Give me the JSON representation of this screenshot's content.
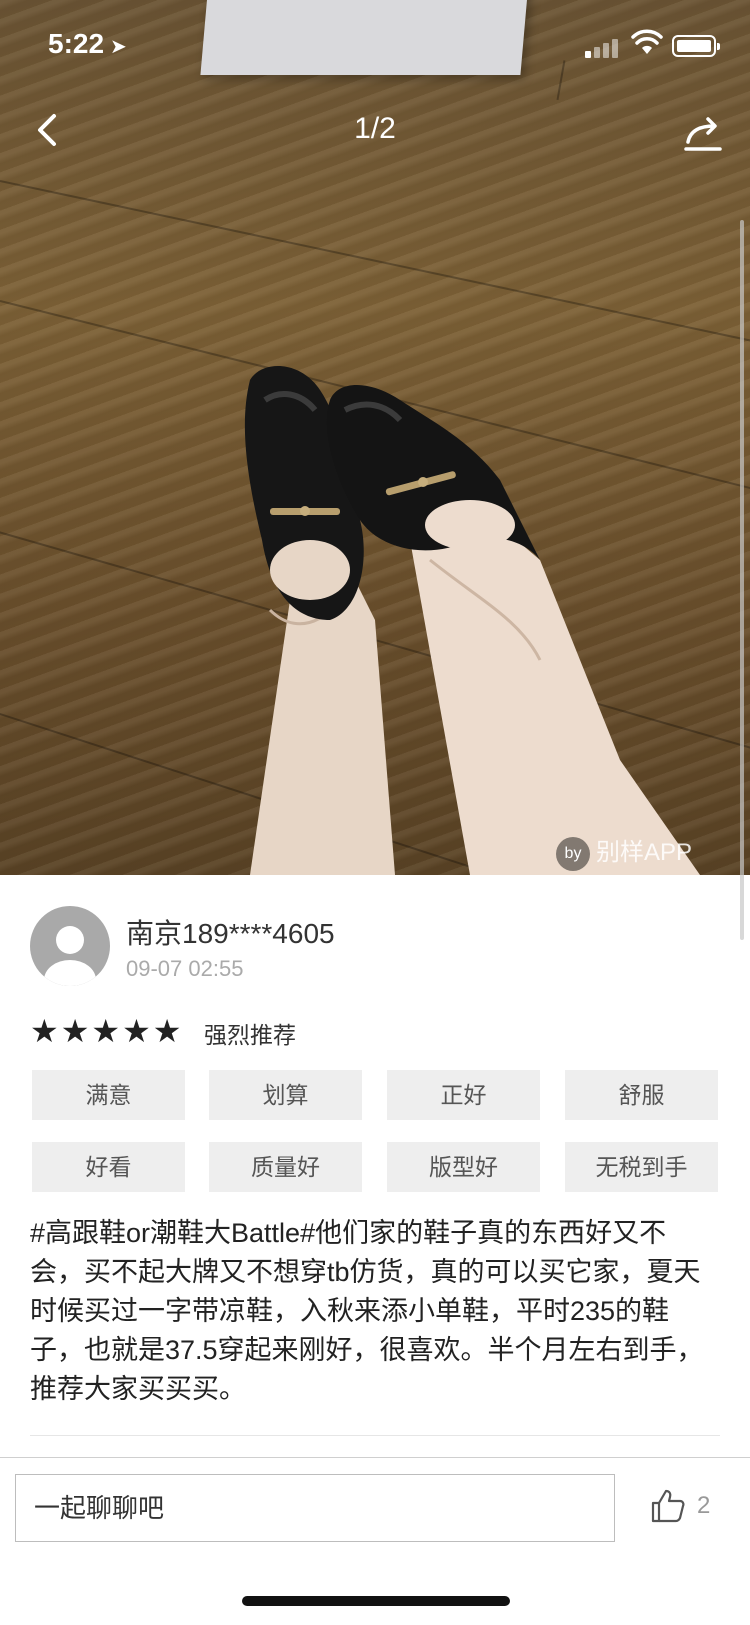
{
  "status_bar": {
    "time": "5:22",
    "location_icon": "location-arrow-icon"
  },
  "nav": {
    "page_indicator": "1/2",
    "back_icon": "chevron-left-icon",
    "share_icon": "share-icon"
  },
  "photo": {
    "watermark": "别样APP"
  },
  "review": {
    "username": "南京189****4605",
    "datetime": "09-07 02:55",
    "stars": "★★★★★",
    "rating_label": "强烈推荐",
    "tags": [
      "满意",
      "划算",
      "正好",
      "舒服",
      "好看",
      "质量好",
      "版型好",
      "无税到手"
    ],
    "text": "#高跟鞋or潮鞋大Battle#他们家的鞋子真的东西好又不会，买不起大牌又不想穿tb仿货，真的可以买它家，夏天时候买过一字带凉鞋，入秋来添小单鞋，平时235的鞋子，也就是37.5穿起来刚好，很喜欢。半个月左右到手，推荐大家买买买。"
  },
  "bottom_bar": {
    "chat_placeholder": "一起聊聊吧",
    "like_count": "2",
    "like_icon": "thumbs-up-icon"
  }
}
